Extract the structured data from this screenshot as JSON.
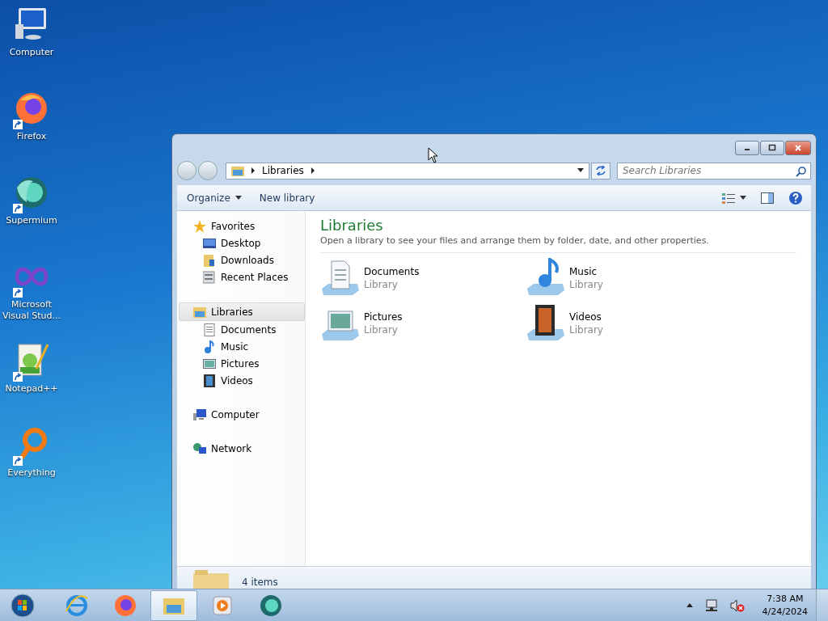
{
  "desktop_icons": [
    {
      "label": "Computer",
      "kind": "computer",
      "shortcut": false
    },
    {
      "label": "Firefox",
      "kind": "firefox",
      "shortcut": true
    },
    {
      "label": "Supermium",
      "kind": "supermium",
      "shortcut": true
    },
    {
      "label": "Microsoft Visual Stud...",
      "kind": "infinity",
      "shortcut": true
    },
    {
      "label": "Notepad++",
      "kind": "notepad",
      "shortcut": true
    },
    {
      "label": "Everything",
      "kind": "everything",
      "shortcut": true
    }
  ],
  "window": {
    "address": {
      "crumbs": [
        "Libraries"
      ]
    },
    "search": {
      "placeholder": "Search Libraries"
    },
    "toolbar": [
      {
        "label": "Organize",
        "dropdown": true
      },
      {
        "label": "New library",
        "dropdown": false
      }
    ],
    "nav": [
      {
        "label": "Favorites",
        "kind": "star",
        "selected": false,
        "children": [
          {
            "label": "Desktop",
            "kind": "desktop",
            "selected": false
          },
          {
            "label": "Downloads",
            "kind": "downloads",
            "selected": false
          },
          {
            "label": "Recent Places",
            "kind": "recent",
            "selected": false
          }
        ]
      },
      {
        "label": "Libraries",
        "kind": "libraries",
        "selected": true,
        "children": [
          {
            "label": "Documents",
            "kind": "documents",
            "selected": false
          },
          {
            "label": "Music",
            "kind": "music",
            "selected": false
          },
          {
            "label": "Pictures",
            "kind": "pictures",
            "selected": false
          },
          {
            "label": "Videos",
            "kind": "videos",
            "selected": false
          }
        ]
      },
      {
        "label": "Computer",
        "kind": "computer",
        "selected": false
      },
      {
        "label": "Network",
        "kind": "network",
        "selected": false
      }
    ],
    "title": "Libraries",
    "description": "Open a library to see your files and arrange them by folder, date, and other properties.",
    "libraries": [
      {
        "name": "Documents",
        "type": "Library",
        "kind": "documents"
      },
      {
        "name": "Music",
        "type": "Library",
        "kind": "music"
      },
      {
        "name": "Pictures",
        "type": "Library",
        "kind": "pictures"
      },
      {
        "name": "Videos",
        "type": "Library",
        "kind": "videos"
      }
    ],
    "status": "4 items"
  },
  "taskbar": {
    "apps": [
      {
        "kind": "ie",
        "selected": false
      },
      {
        "kind": "firefox",
        "selected": false
      },
      {
        "kind": "explorer",
        "selected": true
      },
      {
        "kind": "media",
        "selected": false
      },
      {
        "kind": "supermium",
        "selected": false
      }
    ],
    "time": "7:38 AM",
    "date": "4/24/2024"
  }
}
